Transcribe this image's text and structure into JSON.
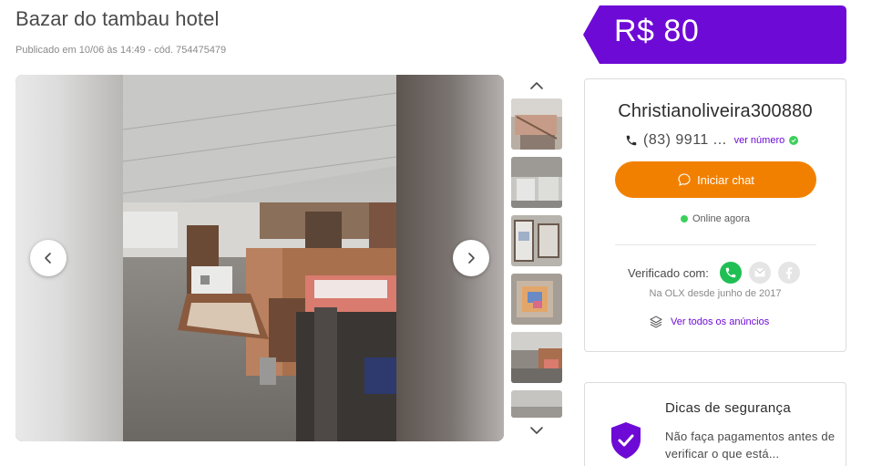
{
  "listing": {
    "title": "Bazar do tambau hotel",
    "meta": "Publicado em 10/06 às 14:49 - cód. 754475479",
    "price": "R$ 80"
  },
  "gallery": {
    "thumbnail_count": 6
  },
  "seller": {
    "name": "Christianoliveira300880",
    "phone": "(83) 9911 ...",
    "see_number": "ver número",
    "chat_button": "Iniciar chat",
    "status": "Online agora",
    "verified_label": "Verificado com:",
    "since": "Na OLX desde junho de 2017",
    "all_ads": "Ver todos os anúncios"
  },
  "safety": {
    "title": "Dicas de segurança",
    "text": "Não faça pagamentos antes de verificar o que está..."
  },
  "colors": {
    "brand_purple": "#6e0ad6",
    "chat_orange": "#f28000",
    "online_green": "#3cd05b",
    "whatsapp_green": "#1fbf54"
  },
  "icons": [
    "chevron-left-icon",
    "chevron-right-icon",
    "chevron-up-icon",
    "chevron-down-icon",
    "phone-icon",
    "check-icon",
    "chat-bubble-icon",
    "whatsapp-icon",
    "email-icon",
    "facebook-icon",
    "layers-icon",
    "shield-check-icon"
  ]
}
